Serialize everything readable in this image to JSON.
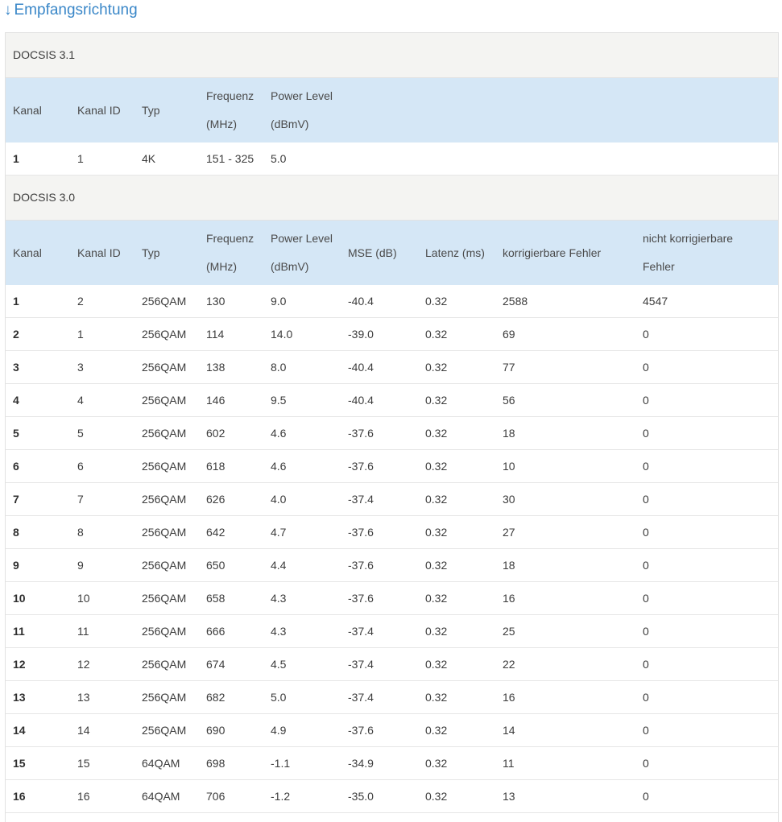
{
  "section": {
    "arrow": "↓",
    "title": "Empfangsrichtung"
  },
  "docsis31": {
    "title": "DOCSIS 3.1",
    "headers": [
      "Kanal",
      "Kanal ID",
      "Typ",
      "Frequenz\n(MHz)",
      "Power Level\n(dBmV)"
    ],
    "rows": [
      [
        "1",
        "1",
        "4K",
        "151 - 325",
        "5.0"
      ]
    ]
  },
  "docsis30": {
    "title": "DOCSIS 3.0",
    "headers": [
      "Kanal",
      "Kanal ID",
      "Typ",
      "Frequenz\n(MHz)",
      "Power Level\n(dBmV)",
      "MSE (dB)",
      "Latenz (ms)",
      "korrigierbare Fehler",
      "nicht korrigierbare\nFehler"
    ],
    "rows": [
      [
        "1",
        "2",
        "256QAM",
        "130",
        "9.0",
        "-40.4",
        "0.32",
        "2588",
        "4547"
      ],
      [
        "2",
        "1",
        "256QAM",
        "114",
        "14.0",
        "-39.0",
        "0.32",
        "69",
        "0"
      ],
      [
        "3",
        "3",
        "256QAM",
        "138",
        "8.0",
        "-40.4",
        "0.32",
        "77",
        "0"
      ],
      [
        "4",
        "4",
        "256QAM",
        "146",
        "9.5",
        "-40.4",
        "0.32",
        "56",
        "0"
      ],
      [
        "5",
        "5",
        "256QAM",
        "602",
        "4.6",
        "-37.6",
        "0.32",
        "18",
        "0"
      ],
      [
        "6",
        "6",
        "256QAM",
        "618",
        "4.6",
        "-37.6",
        "0.32",
        "10",
        "0"
      ],
      [
        "7",
        "7",
        "256QAM",
        "626",
        "4.0",
        "-37.4",
        "0.32",
        "30",
        "0"
      ],
      [
        "8",
        "8",
        "256QAM",
        "642",
        "4.7",
        "-37.6",
        "0.32",
        "27",
        "0"
      ],
      [
        "9",
        "9",
        "256QAM",
        "650",
        "4.4",
        "-37.6",
        "0.32",
        "18",
        "0"
      ],
      [
        "10",
        "10",
        "256QAM",
        "658",
        "4.3",
        "-37.6",
        "0.32",
        "16",
        "0"
      ],
      [
        "11",
        "11",
        "256QAM",
        "666",
        "4.3",
        "-37.4",
        "0.32",
        "25",
        "0"
      ],
      [
        "12",
        "12",
        "256QAM",
        "674",
        "4.5",
        "-37.4",
        "0.32",
        "22",
        "0"
      ],
      [
        "13",
        "13",
        "256QAM",
        "682",
        "5.0",
        "-37.4",
        "0.32",
        "16",
        "0"
      ],
      [
        "14",
        "14",
        "256QAM",
        "690",
        "4.9",
        "-37.6",
        "0.32",
        "14",
        "0"
      ],
      [
        "15",
        "15",
        "64QAM",
        "698",
        "-1.1",
        "-34.9",
        "0.32",
        "11",
        "0"
      ],
      [
        "16",
        "16",
        "64QAM",
        "706",
        "-1.2",
        "-35.0",
        "0.32",
        "13",
        "0"
      ]
    ]
  }
}
